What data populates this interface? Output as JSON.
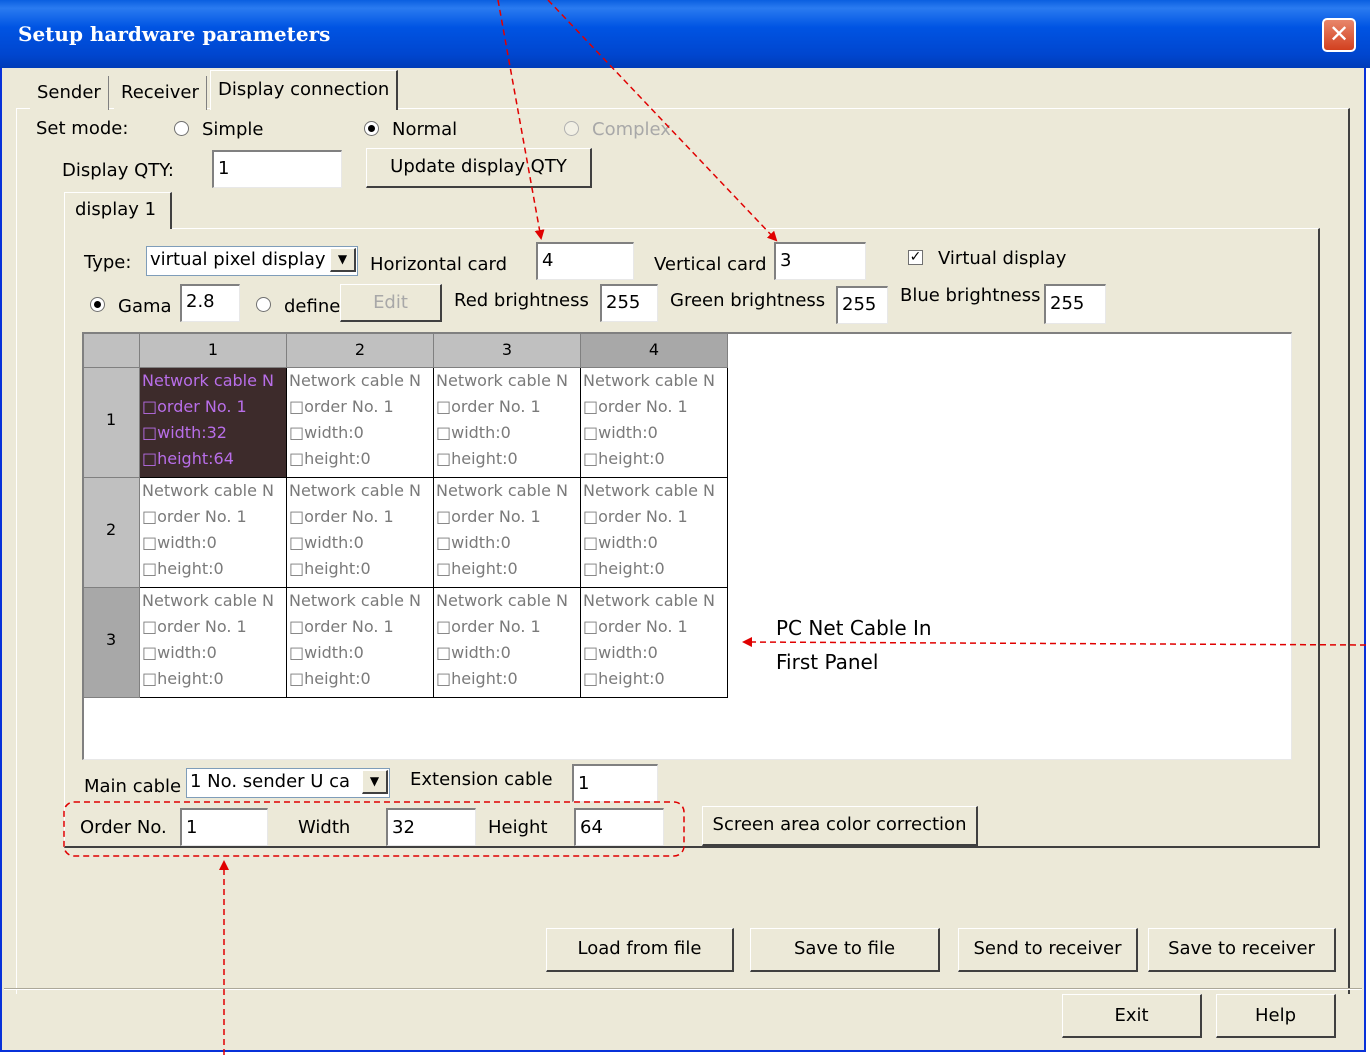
{
  "window": {
    "title": "Setup hardware parameters",
    "close_glyph": "✕"
  },
  "tabs": [
    "Sender",
    "Receiver",
    "Display connection"
  ],
  "mode": {
    "label": "Set mode:",
    "simple": "Simple",
    "normal": "Normal",
    "complex": "Complex"
  },
  "display_qty": {
    "label": "Display QTY:",
    "value": "1",
    "update_button": "Update display QTY"
  },
  "display_tab": "display 1",
  "type_row": {
    "type_label": "Type:",
    "type_value": "virtual pixel display",
    "horizontal_label": "Horizontal card",
    "horizontal_value": "4",
    "vertical_label": "Vertical card",
    "vertical_value": "3",
    "virtual_label": "Virtual display"
  },
  "gamma_row": {
    "gama_label": "Gama",
    "gama_value": "2.8",
    "define_label": "define",
    "edit_button": "Edit",
    "red_label": "Red brightness",
    "red_value": "255",
    "green_label": "Green brightness",
    "green_value": "255",
    "blue_label": "Blue brightness",
    "blue_value": "255"
  },
  "grid": {
    "col_headers": [
      "1",
      "2",
      "3",
      "4"
    ],
    "row_headers": [
      "1",
      "2",
      "3"
    ],
    "cells": [
      [
        {
          "l1": "Network cable N",
          "l2": "□order No. 1",
          "l3": "□width:32",
          "l4": "□height:64"
        },
        {
          "l1": "Network cable N",
          "l2": "□order No. 1",
          "l3": "□width:0",
          "l4": "□height:0"
        },
        {
          "l1": "Network cable N",
          "l2": "□order No. 1",
          "l3": "□width:0",
          "l4": "□height:0"
        },
        {
          "l1": "Network cable N",
          "l2": "□order No. 1",
          "l3": "□width:0",
          "l4": "□height:0"
        }
      ],
      [
        {
          "l1": "Network cable N",
          "l2": "□order No. 1",
          "l3": "□width:0",
          "l4": "□height:0"
        },
        {
          "l1": "Network cable N",
          "l2": "□order No. 1",
          "l3": "□width:0",
          "l4": "□height:0"
        },
        {
          "l1": "Network cable N",
          "l2": "□order No. 1",
          "l3": "□width:0",
          "l4": "□height:0"
        },
        {
          "l1": "Network cable N",
          "l2": "□order No. 1",
          "l3": "□width:0",
          "l4": "□height:0"
        }
      ],
      [
        {
          "l1": "Network cable N",
          "l2": "□order No. 1",
          "l3": "□width:0",
          "l4": "□height:0"
        },
        {
          "l1": "Network cable N",
          "l2": "□order No. 1",
          "l3": "□width:0",
          "l4": "□height:0"
        },
        {
          "l1": "Network cable N",
          "l2": "□order No. 1",
          "l3": "□width:0",
          "l4": "□height:0"
        },
        {
          "l1": "Network cable N",
          "l2": "□order No. 1",
          "l3": "□width:0",
          "l4": "□height:0"
        }
      ]
    ]
  },
  "cable_row": {
    "main_label": "Main cable",
    "main_value": "1 No. sender U ca",
    "ext_label": "Extension cable",
    "ext_value": "1"
  },
  "order_row": {
    "order_label": "Order No.",
    "order_value": "1",
    "width_label": "Width",
    "width_value": "32",
    "height_label": "Height",
    "height_value": "64",
    "color_button": "Screen area color correction"
  },
  "file_buttons": [
    "Load from file",
    "Save to file",
    "Send to receiver",
    "Save to receiver"
  ],
  "footer_buttons": {
    "exit": "Exit",
    "help": "Help"
  },
  "annotation": {
    "line1": "PC Net Cable In",
    "line2": "First Panel"
  },
  "colors": {
    "annotation_red": "#E00000",
    "selected_cell_bg": "#3D2B2B",
    "selected_cell_text": "#B86EE8",
    "title_blue": "#0054E3"
  }
}
